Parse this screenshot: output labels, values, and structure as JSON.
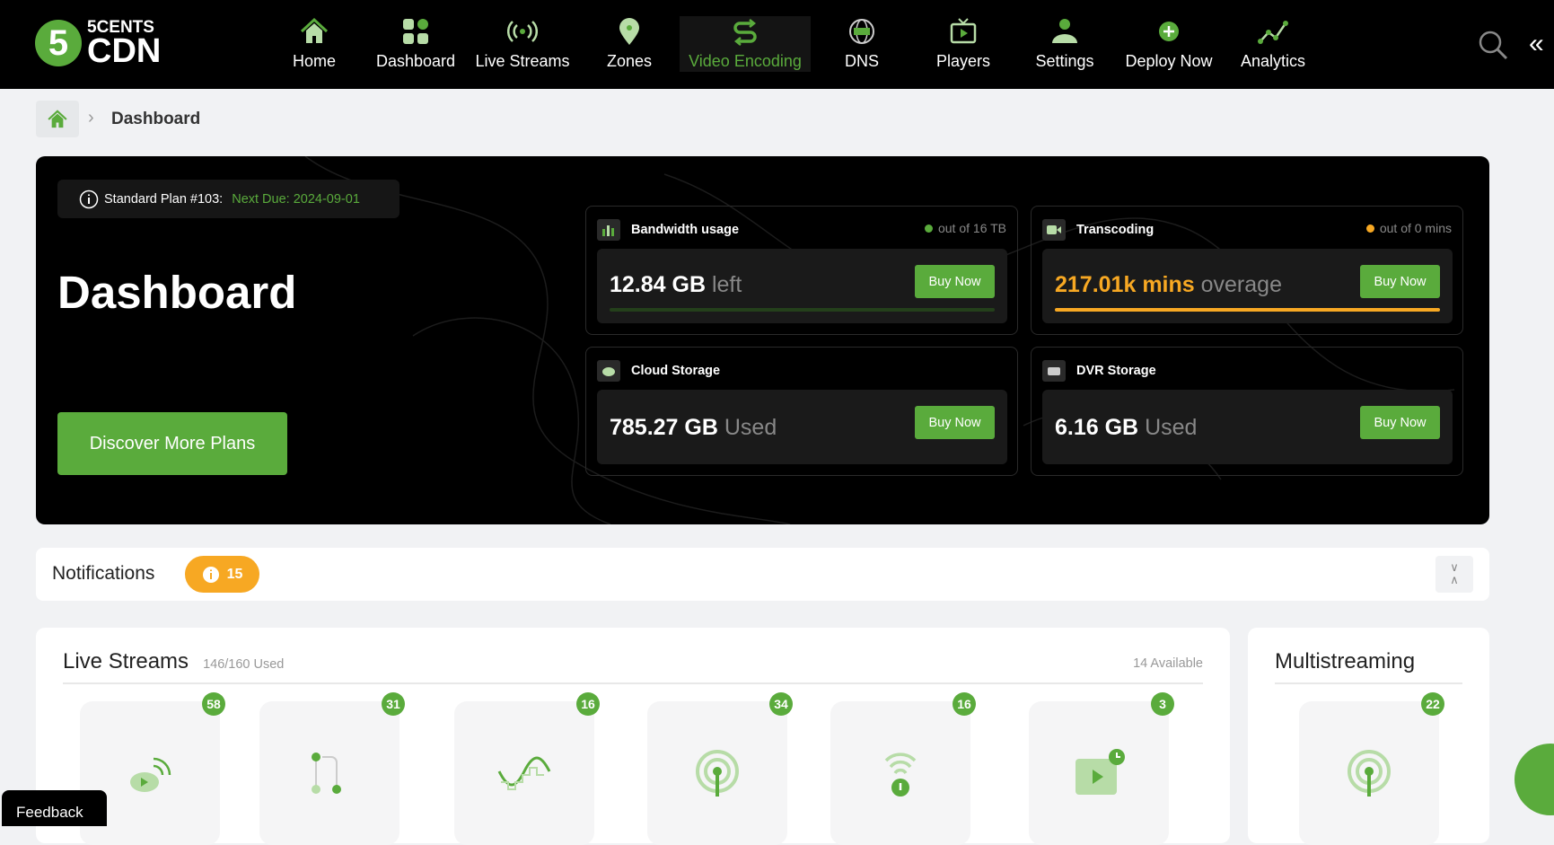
{
  "brand": {
    "top": "5CENTS",
    "bottom": "CDN",
    "mark": "5"
  },
  "nav": [
    {
      "label": "Home",
      "icon": "home-icon"
    },
    {
      "label": "Dashboard",
      "icon": "grid-icon"
    },
    {
      "label": "Live Streams",
      "icon": "broadcast-icon"
    },
    {
      "label": "Zones",
      "icon": "location-pin-icon"
    },
    {
      "label": "Video Encoding",
      "icon": "encoding-icon",
      "active": true
    },
    {
      "label": "DNS",
      "icon": "globe-icon"
    },
    {
      "label": "Players",
      "icon": "tv-icon"
    },
    {
      "label": "Settings",
      "icon": "user-settings-icon"
    },
    {
      "label": "Deploy Now",
      "icon": "plus-circle-icon"
    },
    {
      "label": "Analytics",
      "icon": "line-chart-icon"
    }
  ],
  "breadcrumb": {
    "current": "Dashboard"
  },
  "hero": {
    "plan": "Standard Plan #103:",
    "next_due": "Next Due: 2024-09-01",
    "title": "Dashboard",
    "discover": "Discover More Plans",
    "cards": {
      "bandwidth": {
        "title": "Bandwidth usage",
        "quota": "out of 16 TB",
        "value": "12.84 GB",
        "unit": "left",
        "buy": "Buy Now",
        "progress": 0.0
      },
      "transcoding": {
        "title": "Transcoding",
        "quota": "out of 0 mins",
        "value": "217.01k mins",
        "unit": "overage",
        "buy": "Buy Now",
        "progress": 1.0
      },
      "cloud": {
        "title": "Cloud Storage",
        "value": "785.27 GB",
        "unit": "Used",
        "buy": "Buy Now"
      },
      "dvr": {
        "title": "DVR Storage",
        "value": "6.16 GB",
        "unit": "Used",
        "buy": "Buy Now"
      }
    }
  },
  "notifications": {
    "title": "Notifications",
    "count": "15"
  },
  "live_streams": {
    "title": "Live Streams",
    "used": "146/160 Used",
    "available": "14 Available",
    "tiles": [
      "58",
      "31",
      "16",
      "34",
      "16",
      "3"
    ]
  },
  "multistreaming": {
    "title": "Multistreaming",
    "count": "22"
  },
  "feedback": "Feedback",
  "colors": {
    "accent": "#5aab3c",
    "warning": "#f7a823"
  }
}
